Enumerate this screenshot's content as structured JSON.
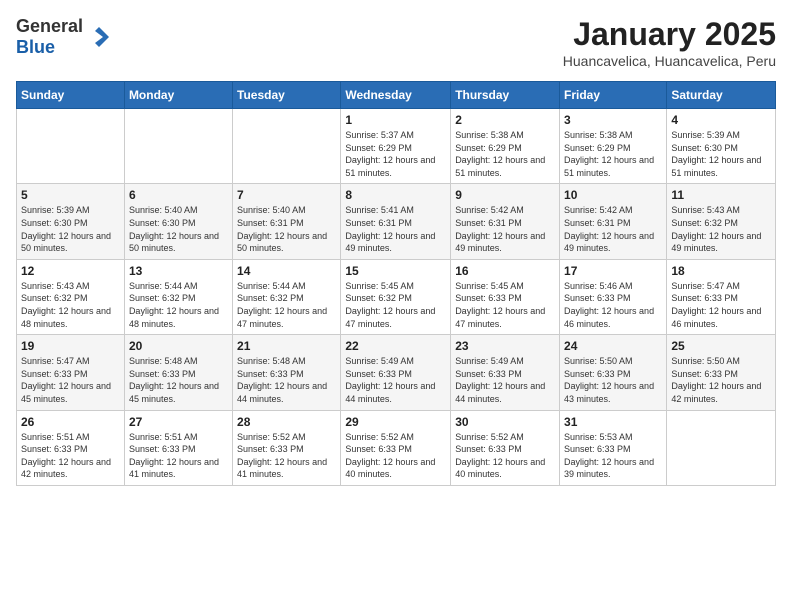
{
  "logo": {
    "general": "General",
    "blue": "Blue"
  },
  "title": "January 2025",
  "subtitle": "Huancavelica, Huancavelica, Peru",
  "weekdays": [
    "Sunday",
    "Monday",
    "Tuesday",
    "Wednesday",
    "Thursday",
    "Friday",
    "Saturday"
  ],
  "weeks": [
    [
      {
        "day": "",
        "sunrise": "",
        "sunset": "",
        "daylight": ""
      },
      {
        "day": "",
        "sunrise": "",
        "sunset": "",
        "daylight": ""
      },
      {
        "day": "",
        "sunrise": "",
        "sunset": "",
        "daylight": ""
      },
      {
        "day": "1",
        "sunrise": "Sunrise: 5:37 AM",
        "sunset": "Sunset: 6:29 PM",
        "daylight": "Daylight: 12 hours and 51 minutes."
      },
      {
        "day": "2",
        "sunrise": "Sunrise: 5:38 AM",
        "sunset": "Sunset: 6:29 PM",
        "daylight": "Daylight: 12 hours and 51 minutes."
      },
      {
        "day": "3",
        "sunrise": "Sunrise: 5:38 AM",
        "sunset": "Sunset: 6:29 PM",
        "daylight": "Daylight: 12 hours and 51 minutes."
      },
      {
        "day": "4",
        "sunrise": "Sunrise: 5:39 AM",
        "sunset": "Sunset: 6:30 PM",
        "daylight": "Daylight: 12 hours and 51 minutes."
      }
    ],
    [
      {
        "day": "5",
        "sunrise": "Sunrise: 5:39 AM",
        "sunset": "Sunset: 6:30 PM",
        "daylight": "Daylight: 12 hours and 50 minutes."
      },
      {
        "day": "6",
        "sunrise": "Sunrise: 5:40 AM",
        "sunset": "Sunset: 6:30 PM",
        "daylight": "Daylight: 12 hours and 50 minutes."
      },
      {
        "day": "7",
        "sunrise": "Sunrise: 5:40 AM",
        "sunset": "Sunset: 6:31 PM",
        "daylight": "Daylight: 12 hours and 50 minutes."
      },
      {
        "day": "8",
        "sunrise": "Sunrise: 5:41 AM",
        "sunset": "Sunset: 6:31 PM",
        "daylight": "Daylight: 12 hours and 49 minutes."
      },
      {
        "day": "9",
        "sunrise": "Sunrise: 5:42 AM",
        "sunset": "Sunset: 6:31 PM",
        "daylight": "Daylight: 12 hours and 49 minutes."
      },
      {
        "day": "10",
        "sunrise": "Sunrise: 5:42 AM",
        "sunset": "Sunset: 6:31 PM",
        "daylight": "Daylight: 12 hours and 49 minutes."
      },
      {
        "day": "11",
        "sunrise": "Sunrise: 5:43 AM",
        "sunset": "Sunset: 6:32 PM",
        "daylight": "Daylight: 12 hours and 49 minutes."
      }
    ],
    [
      {
        "day": "12",
        "sunrise": "Sunrise: 5:43 AM",
        "sunset": "Sunset: 6:32 PM",
        "daylight": "Daylight: 12 hours and 48 minutes."
      },
      {
        "day": "13",
        "sunrise": "Sunrise: 5:44 AM",
        "sunset": "Sunset: 6:32 PM",
        "daylight": "Daylight: 12 hours and 48 minutes."
      },
      {
        "day": "14",
        "sunrise": "Sunrise: 5:44 AM",
        "sunset": "Sunset: 6:32 PM",
        "daylight": "Daylight: 12 hours and 47 minutes."
      },
      {
        "day": "15",
        "sunrise": "Sunrise: 5:45 AM",
        "sunset": "Sunset: 6:32 PM",
        "daylight": "Daylight: 12 hours and 47 minutes."
      },
      {
        "day": "16",
        "sunrise": "Sunrise: 5:45 AM",
        "sunset": "Sunset: 6:33 PM",
        "daylight": "Daylight: 12 hours and 47 minutes."
      },
      {
        "day": "17",
        "sunrise": "Sunrise: 5:46 AM",
        "sunset": "Sunset: 6:33 PM",
        "daylight": "Daylight: 12 hours and 46 minutes."
      },
      {
        "day": "18",
        "sunrise": "Sunrise: 5:47 AM",
        "sunset": "Sunset: 6:33 PM",
        "daylight": "Daylight: 12 hours and 46 minutes."
      }
    ],
    [
      {
        "day": "19",
        "sunrise": "Sunrise: 5:47 AM",
        "sunset": "Sunset: 6:33 PM",
        "daylight": "Daylight: 12 hours and 45 minutes."
      },
      {
        "day": "20",
        "sunrise": "Sunrise: 5:48 AM",
        "sunset": "Sunset: 6:33 PM",
        "daylight": "Daylight: 12 hours and 45 minutes."
      },
      {
        "day": "21",
        "sunrise": "Sunrise: 5:48 AM",
        "sunset": "Sunset: 6:33 PM",
        "daylight": "Daylight: 12 hours and 44 minutes."
      },
      {
        "day": "22",
        "sunrise": "Sunrise: 5:49 AM",
        "sunset": "Sunset: 6:33 PM",
        "daylight": "Daylight: 12 hours and 44 minutes."
      },
      {
        "day": "23",
        "sunrise": "Sunrise: 5:49 AM",
        "sunset": "Sunset: 6:33 PM",
        "daylight": "Daylight: 12 hours and 44 minutes."
      },
      {
        "day": "24",
        "sunrise": "Sunrise: 5:50 AM",
        "sunset": "Sunset: 6:33 PM",
        "daylight": "Daylight: 12 hours and 43 minutes."
      },
      {
        "day": "25",
        "sunrise": "Sunrise: 5:50 AM",
        "sunset": "Sunset: 6:33 PM",
        "daylight": "Daylight: 12 hours and 42 minutes."
      }
    ],
    [
      {
        "day": "26",
        "sunrise": "Sunrise: 5:51 AM",
        "sunset": "Sunset: 6:33 PM",
        "daylight": "Daylight: 12 hours and 42 minutes."
      },
      {
        "day": "27",
        "sunrise": "Sunrise: 5:51 AM",
        "sunset": "Sunset: 6:33 PM",
        "daylight": "Daylight: 12 hours and 41 minutes."
      },
      {
        "day": "28",
        "sunrise": "Sunrise: 5:52 AM",
        "sunset": "Sunset: 6:33 PM",
        "daylight": "Daylight: 12 hours and 41 minutes."
      },
      {
        "day": "29",
        "sunrise": "Sunrise: 5:52 AM",
        "sunset": "Sunset: 6:33 PM",
        "daylight": "Daylight: 12 hours and 40 minutes."
      },
      {
        "day": "30",
        "sunrise": "Sunrise: 5:52 AM",
        "sunset": "Sunset: 6:33 PM",
        "daylight": "Daylight: 12 hours and 40 minutes."
      },
      {
        "day": "31",
        "sunrise": "Sunrise: 5:53 AM",
        "sunset": "Sunset: 6:33 PM",
        "daylight": "Daylight: 12 hours and 39 minutes."
      },
      {
        "day": "",
        "sunrise": "",
        "sunset": "",
        "daylight": ""
      }
    ]
  ]
}
